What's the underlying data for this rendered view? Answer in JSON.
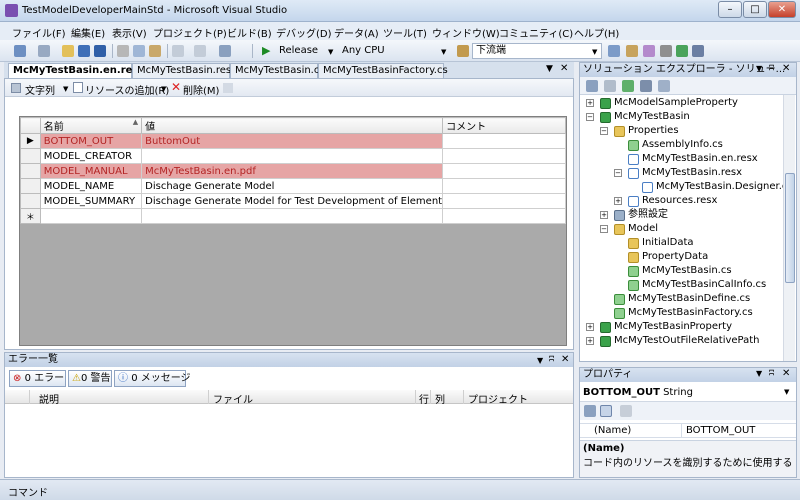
{
  "window": {
    "title": "TestModelDeveloperMainStd - Microsoft Visual Studio",
    "btn_min": "–",
    "btn_max": "□",
    "btn_close": "✕"
  },
  "menu": [
    "ファイル(F)",
    "編集(E)",
    "表示(V)",
    "プロジェクト(P)",
    "ビルド(B)",
    "デバッグ(D)",
    "データ(A)",
    "ツール(T)",
    "ウィンドウ(W)",
    "コミュニティ(C)",
    "ヘルプ(H)"
  ],
  "toolbar": {
    "config": "Release",
    "platform": "Any CPU",
    "find": "下流端"
  },
  "doc_tabs": [
    "McMyTestBasin.en.resx",
    "McMyTestBasin.resx",
    "McMyTestBasin.cs",
    "McMyTestBasinFactory.cs"
  ],
  "resource_toolbar": {
    "strings": "文字列",
    "add_resource": "リソースの追加(R)",
    "delete": "削除(M)"
  },
  "grid": {
    "headers": {
      "name": "名前",
      "value": "値",
      "comment": "コメント"
    },
    "rows": [
      {
        "name": "BOTTOM_OUT",
        "value": "ButtomOut",
        "comment": ""
      },
      {
        "name": "MODEL_CREATOR",
        "value": "",
        "comment": ""
      },
      {
        "name": "MODEL_MANUAL",
        "value": "McMyTestBasin.en.pdf",
        "comment": ""
      },
      {
        "name": "MODEL_NAME",
        "value": "Dischage Generate Model",
        "comment": ""
      },
      {
        "name": "MODEL_SUMMARY",
        "value": "Dischage Generate Model for Test Development of Element",
        "comment": ""
      }
    ],
    "current_marker": "▶",
    "new_row_marker": "＊"
  },
  "error_list": {
    "title": "エラー一覧",
    "errors": "0 エラー",
    "warnings": "0 警告",
    "messages": "0 メッセージ",
    "columns": {
      "description": "説明",
      "file": "ファイル",
      "line": "行",
      "column": "列",
      "project": "プロジェクト"
    }
  },
  "solution_explorer": {
    "title": "ソリューション エクスプローラ - ソリュー...",
    "nodes": [
      "McModelSampleProperty",
      "McMyTestBasin",
      "Properties",
      "AssemblyInfo.cs",
      "McMyTestBasin.en.resx",
      "McMyTestBasin.resx",
      "McMyTestBasin.Designer.cs",
      "Resources.resx",
      "参照設定",
      "Model",
      "InitialData",
      "PropertyData",
      "McMyTestBasin.cs",
      "McMyTestBasinCalInfo.cs",
      "McMyTestBasinDefine.cs",
      "McMyTestBasinFactory.cs",
      "McMyTestBasinProperty",
      "McMyTestOutFileRelativePath"
    ]
  },
  "properties": {
    "title": "プロパティ",
    "object": "BOTTOM_OUT",
    "object_type": "String",
    "prop_name": "(Name)",
    "prop_value": "BOTTOM_OUT",
    "desc_title": "(Name)",
    "desc_text": "コード内のリソースを識別するために使用する名前..."
  },
  "status": {
    "text": "コマンド"
  },
  "colors": {
    "accent": "#c4d6ec",
    "selected_cell": "#e6a5a5",
    "selected_text": "#b32424"
  }
}
